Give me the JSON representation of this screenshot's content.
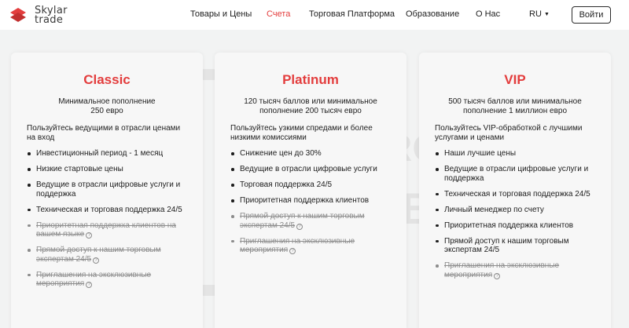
{
  "brand": {
    "line1": "Skylar",
    "line2": "trade"
  },
  "nav": {
    "items": [
      {
        "label": "Товары и Цены"
      },
      {
        "label": "Счета"
      },
      {
        "label": "Торговая Платформа"
      },
      {
        "label": "Образование"
      },
      {
        "label": "О Нас"
      }
    ],
    "language": "RU",
    "login": "Войти"
  },
  "watermark": {
    "line1": "BROKER",
    "line2": "TRIBUNAL"
  },
  "colors": {
    "accent": "#e33d3d",
    "muted": "#8c8c8c"
  },
  "plans": [
    {
      "title": "Classic",
      "subtitle_line1": "Минимальное пополнение",
      "subtitle_line2": "250 евро",
      "desc_line1": "Пользуйтесь ведущими в отрасли ценами",
      "desc_line2": "на вход",
      "features": [
        {
          "lines": [
            "Инвестиционный период - 1 месяц"
          ],
          "enabled": true
        },
        {
          "lines": [
            "Низкие стартовые цены"
          ],
          "enabled": true
        },
        {
          "lines": [
            "Ведущие в отрасли цифровые услуги и",
            "поддержка"
          ],
          "enabled": true
        },
        {
          "lines": [
            "Техническая и торговая поддержка 24/5"
          ],
          "enabled": true
        },
        {
          "lines": [
            "Приоритетная поддержка клиентов на",
            "вашем языке"
          ],
          "enabled": false
        },
        {
          "lines": [
            "Прямой доступ к нашим торговым",
            "экспертам 24/5"
          ],
          "enabled": false
        },
        {
          "lines": [
            "Приглашения на эксклюзивные",
            "мероприятия"
          ],
          "enabled": false
        }
      ]
    },
    {
      "title": "Platinum",
      "subtitle_line1": "120 тысяч баллов или минимальное",
      "subtitle_line2": "пополнение 200 тысяч евро",
      "desc_line1": "Пользуйтесь узкими спредами и более",
      "desc_line2": "низкими комиссиями",
      "features": [
        {
          "lines": [
            "Снижение цен до 30%"
          ],
          "enabled": true
        },
        {
          "lines": [
            "Ведущие в отрасли цифровые услуги"
          ],
          "enabled": true
        },
        {
          "lines": [
            "Торговая поддержка 24/5"
          ],
          "enabled": true
        },
        {
          "lines": [
            "Приоритетная поддержка клиентов"
          ],
          "enabled": true
        },
        {
          "lines": [
            "Прямой доступ к нашим торговым",
            "экспертам 24/5"
          ],
          "enabled": false
        },
        {
          "lines": [
            "Приглашения на эксклюзивные",
            "мероприятия"
          ],
          "enabled": false
        }
      ]
    },
    {
      "title": "VIP",
      "subtitle_line1": "500 тысяч баллов или минимальное",
      "subtitle_line2": "пополнение 1 миллион евро",
      "desc_line1": "Пользуйтесь VIP-обработкой с лучшими",
      "desc_line2": "услугами и ценами",
      "features": [
        {
          "lines": [
            "Наши лучшие цены"
          ],
          "enabled": true
        },
        {
          "lines": [
            "Ведущие в отрасли цифровые услуги и",
            "поддержка"
          ],
          "enabled": true
        },
        {
          "lines": [
            "Техническая и торговая поддержка 24/5"
          ],
          "enabled": true
        },
        {
          "lines": [
            "Личный менеджер по счету"
          ],
          "enabled": true
        },
        {
          "lines": [
            "Приоритетная поддержка клиентов"
          ],
          "enabled": true
        },
        {
          "lines": [
            "Прямой доступ к нашим торговым",
            "экспертам 24/5"
          ],
          "enabled": true
        },
        {
          "lines": [
            "Приглашения на эксклюзивные",
            "мероприятия"
          ],
          "enabled": false
        }
      ]
    }
  ]
}
